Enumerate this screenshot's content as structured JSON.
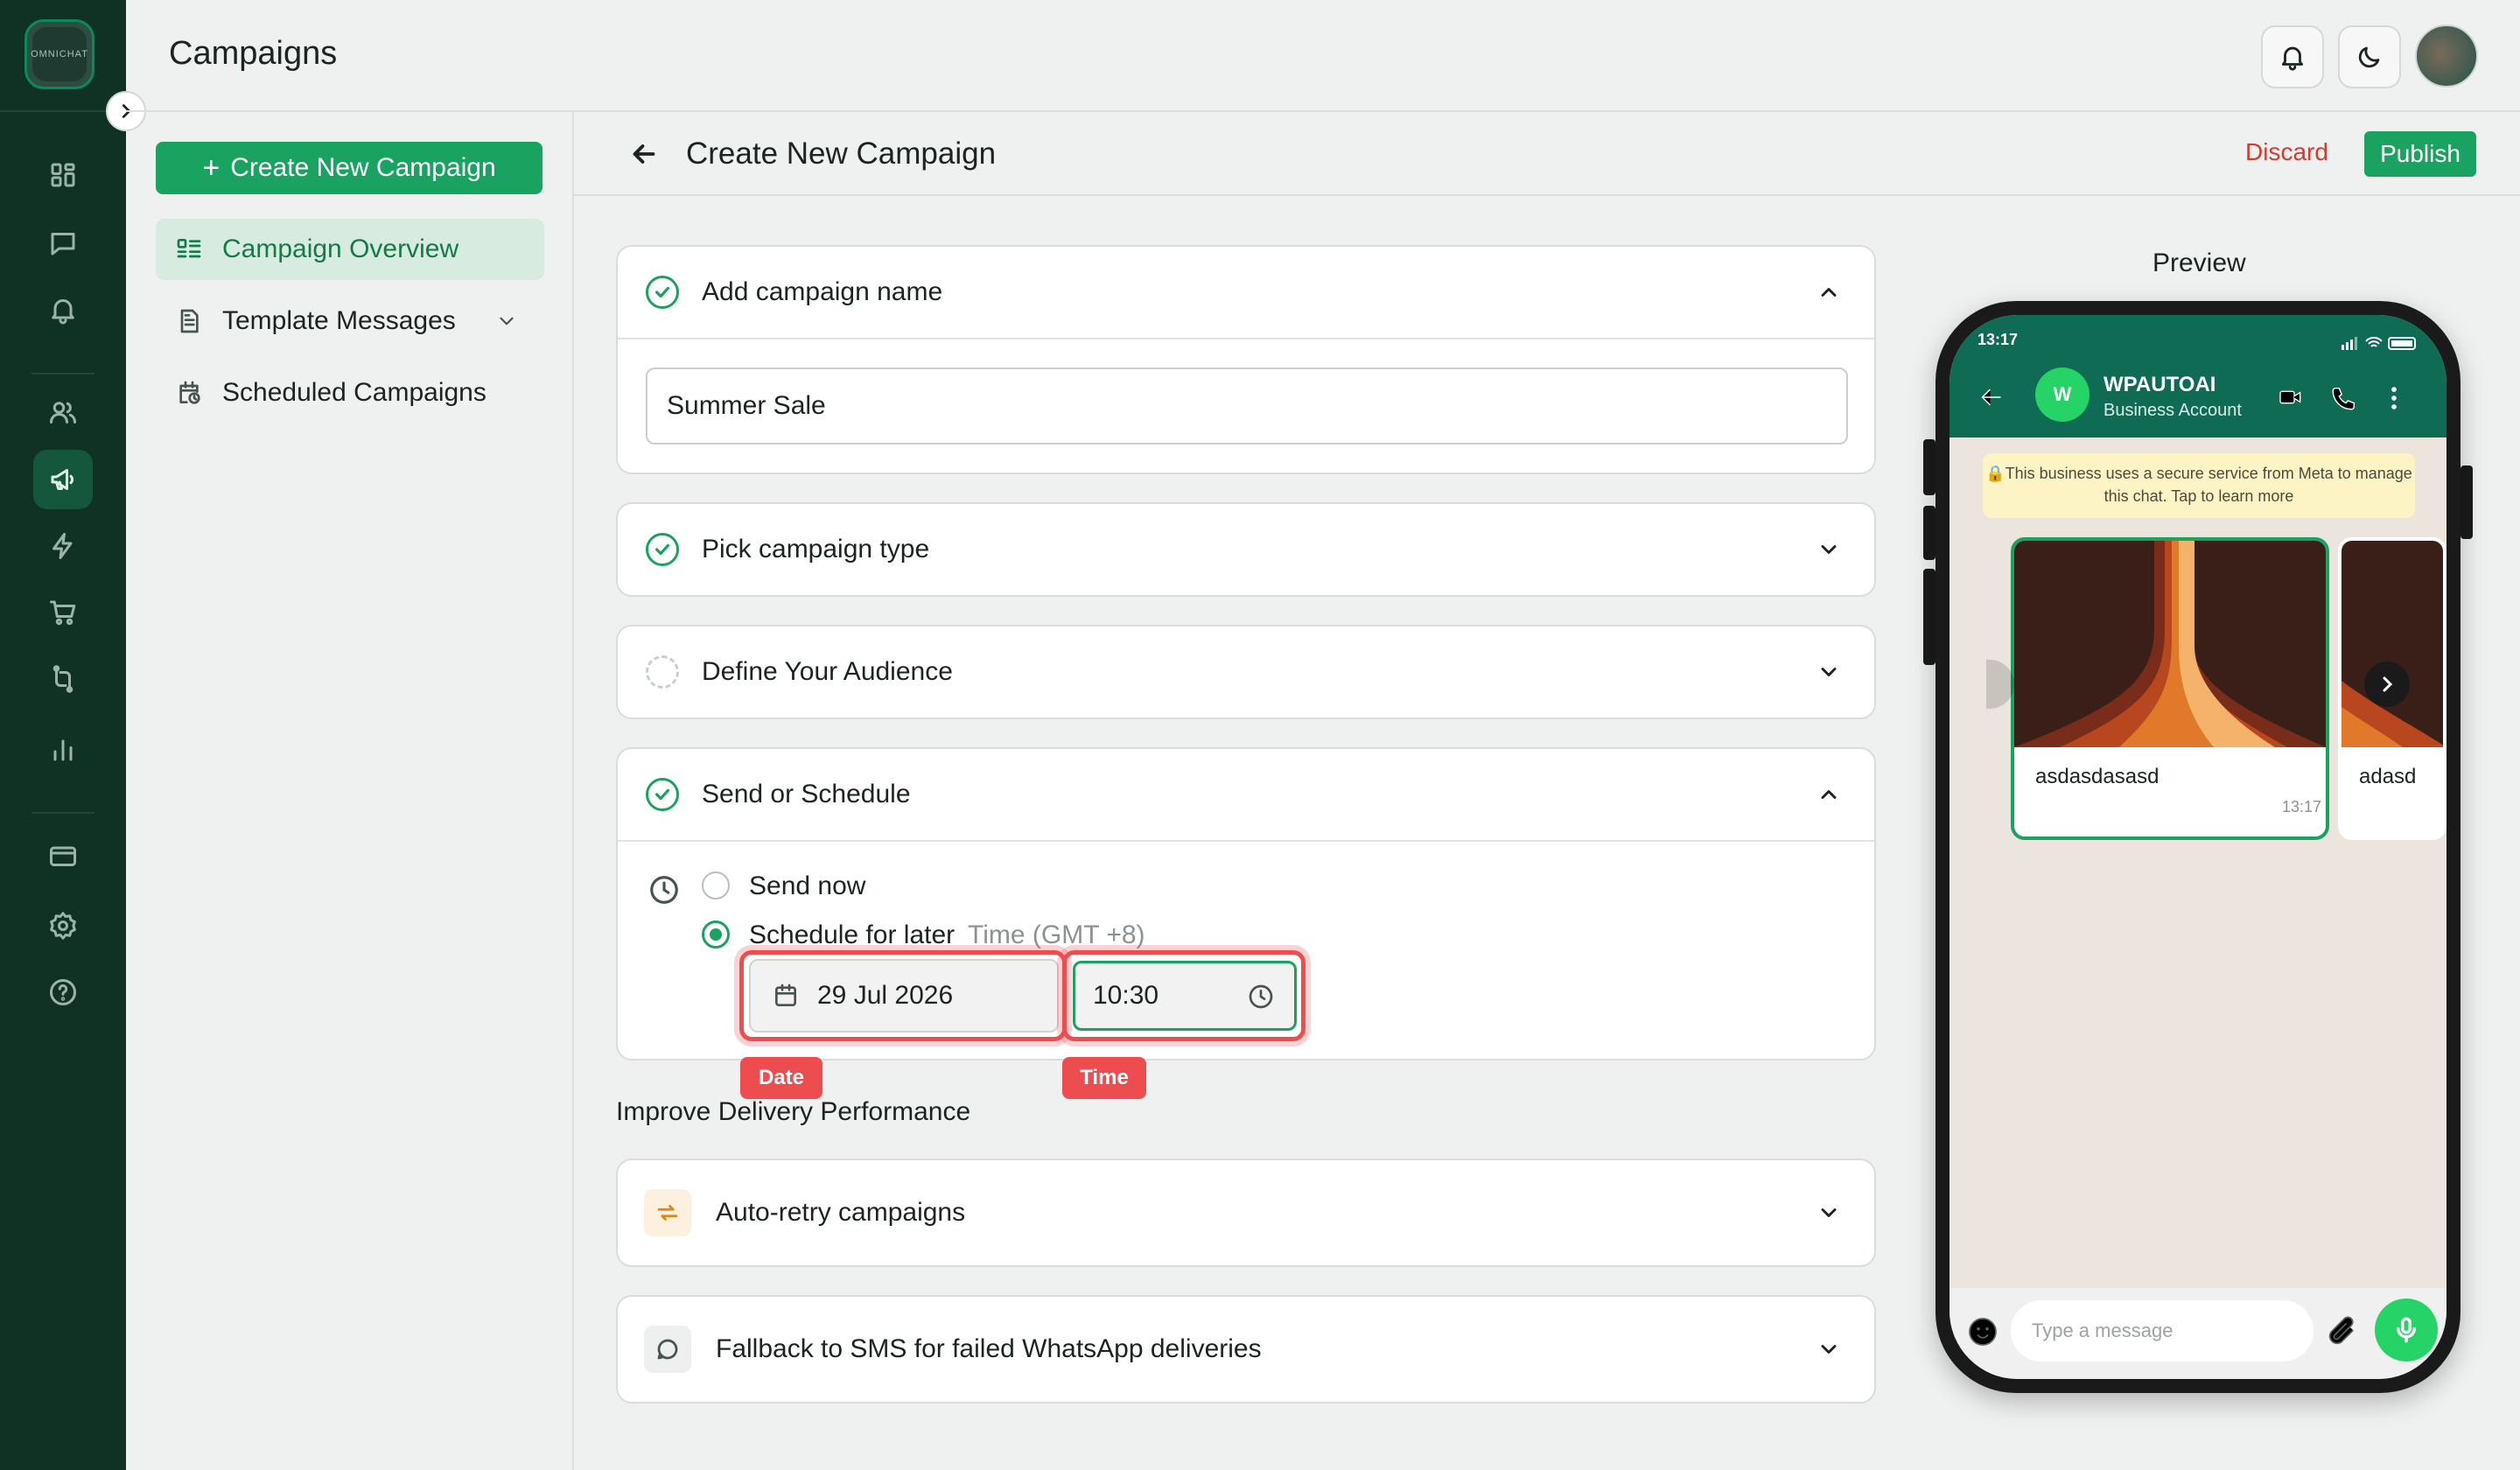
{
  "app": {
    "logo_text": "OMNICHAT",
    "page_title": "Campaigns"
  },
  "rail": {
    "icons": [
      "dashboard-icon",
      "chat-icon",
      "bell-icon",
      "users-icon",
      "megaphone-icon",
      "lightning-icon",
      "cart-icon",
      "flow-icon",
      "analytics-icon",
      "card-icon",
      "settings-icon",
      "help-icon"
    ],
    "active": "megaphone-icon"
  },
  "sidebar": {
    "create_label": "Create New Campaign",
    "items": [
      {
        "label": "Campaign Overview",
        "icon": "list-icon",
        "active": true
      },
      {
        "label": "Template Messages",
        "icon": "document-icon",
        "expandable": true
      },
      {
        "label": "Scheduled Campaigns",
        "icon": "calendar-clock-icon"
      }
    ]
  },
  "form": {
    "title": "Create New Campaign",
    "discard_label": "Discard",
    "publish_label": "Publish",
    "sections": {
      "name": {
        "title": "Add campaign name",
        "value": "Summer Sale",
        "status": "done",
        "expanded": true
      },
      "type": {
        "title": "Pick campaign type",
        "status": "done",
        "expanded": false
      },
      "audience": {
        "title": "Define Your Audience",
        "status": "pending",
        "expanded": false
      },
      "schedule": {
        "title": "Send or Schedule",
        "status": "done",
        "expanded": true,
        "send_now_label": "Send now",
        "schedule_label": "Schedule for later",
        "timezone": "Time (GMT +8)",
        "selected": "schedule",
        "date": "29 Jul 2026",
        "time": "10:30",
        "date_tag": "Date",
        "time_tag": "Time"
      }
    },
    "improve_title": "Improve Delivery Performance",
    "improve": [
      {
        "label": "Auto-retry campaigns",
        "icon": "retry-icon"
      },
      {
        "label": "Fallback to SMS for failed WhatsApp deliveries",
        "icon": "message-icon"
      }
    ]
  },
  "preview": {
    "title": "Preview",
    "clock": "13:17",
    "business_name": "WPAUTOAI",
    "business_sub": "Business Account",
    "avatar_letter": "W",
    "notice": "This business uses a secure service from Meta to manage this chat. Tap to learn more",
    "cards": [
      {
        "text": "asdasdasasd",
        "time": "13:17"
      },
      {
        "text": "adasd"
      }
    ],
    "input_placeholder": "Type a message"
  },
  "colors": {
    "brand": "#1aa261",
    "rail": "#103224",
    "danger": "#d23c30",
    "highlight": "#ee4d50"
  }
}
